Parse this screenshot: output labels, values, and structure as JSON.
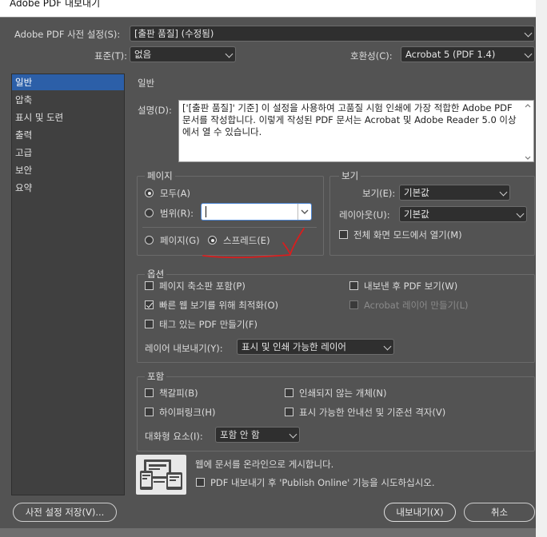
{
  "window": {
    "title": "Adobe PDF 내보내기"
  },
  "header": {
    "preset_label": "Adobe PDF 사전 설정(S):",
    "preset_value": "[출판 품질] (수정됨)",
    "standard_label": "표준(T):",
    "standard_value": "없음",
    "compat_label": "호환성(C):",
    "compat_value": "Acrobat 5 (PDF 1.4)"
  },
  "sidebar": {
    "items": [
      {
        "label": "일반",
        "selected": true
      },
      {
        "label": "압축"
      },
      {
        "label": "표시 및 도련"
      },
      {
        "label": "출력"
      },
      {
        "label": "고급"
      },
      {
        "label": "보안"
      },
      {
        "label": "요약"
      }
    ]
  },
  "main": {
    "section_title": "일반",
    "desc_label": "설명(D):",
    "description": "['[출판 품질]' 기준] 이 설정을 사용하여 고품질 시험 인쇄에 가장 적합한 Adobe PDF 문서를 작성합니다. 이렇게 작성된 PDF 문서는 Acrobat 및 Adobe Reader 5.0 이상에서 열 수 있습니다.",
    "pages": {
      "title": "페이지",
      "all": "모두(A)",
      "range": "범위(R):",
      "range_value": "",
      "pages_opt": "페이지(G)",
      "spreads_opt": "스프레드(E)"
    },
    "view": {
      "title": "보기",
      "view_label": "보기(E):",
      "view_value": "기본값",
      "layout_label": "레이아웃(U):",
      "layout_value": "기본값",
      "fullscreen": "전체 화면 모드에서 열기(M)"
    },
    "options": {
      "title": "옵션",
      "thumbnails": "페이지 축소판 포함(P)",
      "view_after": "내보낸 후 PDF 보기(W)",
      "fast_web": "빠른 웹 보기를 위해 최적화(O)",
      "acrobat_layers": "Acrobat 레이어 만들기(L)",
      "tagged": "태그 있는 PDF 만들기(F)",
      "layer_export_label": "레이어 내보내기(Y):",
      "layer_export_value": "표시 및 인쇄 가능한 레이어"
    },
    "include": {
      "title": "포함",
      "bookmarks": "책갈피(B)",
      "non_printing": "인쇄되지 않는 개체(N)",
      "hyperlinks": "하이퍼링크(H)",
      "guides": "표시 가능한 안내선 및 기준선 격자(V)",
      "interactive_label": "대화형 요소(I):",
      "interactive_value": "포함 안 함"
    },
    "publish": {
      "heading": "웹에 문서를 온라인으로 게시합니다.",
      "checkbox": "PDF 내보내기 후 'Publish Online' 기능을 시도하십시오."
    }
  },
  "footer": {
    "save_preset": "사전 설정 저장(V)...",
    "export": "내보내기(X)",
    "cancel": "취소"
  },
  "colors": {
    "accent": "#2c5fa8",
    "annotation": "#d81e1e"
  }
}
